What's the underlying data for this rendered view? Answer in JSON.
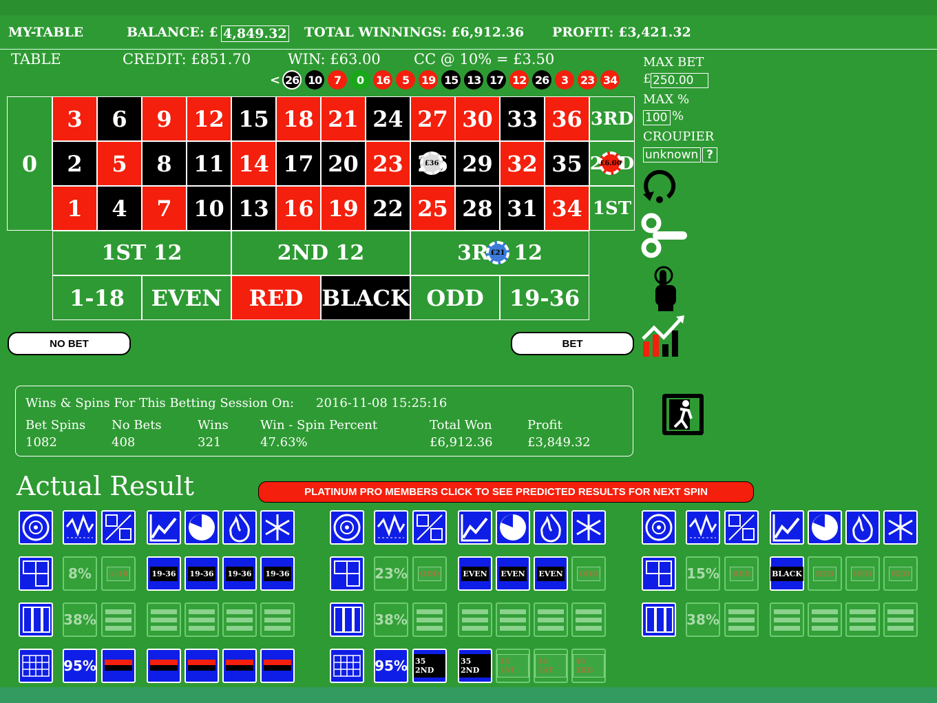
{
  "header": {
    "table": "MY-TABLE",
    "balance_label": "BALANCE: £",
    "balance_value": "4,849.32",
    "total_winnings": "TOTAL WINNINGS: £6,912.36",
    "profit": "PROFIT: £3,421.32"
  },
  "info": {
    "table": "TABLE",
    "credit": "CREDIT: £851.70",
    "win": "WIN: £63.00",
    "cc": "CC @ 10% = £3.50"
  },
  "side": {
    "max_bet_label": "MAX BET",
    "currency": "£",
    "max_bet_value": "250.00",
    "max_pct_label": "MAX %",
    "max_pct_value": "100",
    "pct_sign": "%",
    "croupier_label": "CROUPIER",
    "croupier_value": "unknown",
    "help": "?",
    "icons": [
      "refresh-icon",
      "wind-up-key-icon",
      "hand-pointer-icon",
      "profit-chart-icon",
      "exit-icon"
    ]
  },
  "history": {
    "arrow": "<",
    "numbers": [
      {
        "n": "26",
        "c": "black"
      },
      {
        "n": "10",
        "c": "black"
      },
      {
        "n": "7",
        "c": "red"
      },
      {
        "n": "0",
        "c": "green"
      },
      {
        "n": "16",
        "c": "red"
      },
      {
        "n": "5",
        "c": "red"
      },
      {
        "n": "19",
        "c": "red"
      },
      {
        "n": "15",
        "c": "black"
      },
      {
        "n": "13",
        "c": "black"
      },
      {
        "n": "17",
        "c": "black"
      },
      {
        "n": "12",
        "c": "red"
      },
      {
        "n": "26",
        "c": "black"
      },
      {
        "n": "3",
        "c": "red"
      },
      {
        "n": "23",
        "c": "red"
      },
      {
        "n": "34",
        "c": "red"
      }
    ]
  },
  "board": {
    "zero": "0",
    "rows": [
      [
        {
          "n": "3",
          "c": "red"
        },
        {
          "n": "6",
          "c": "black"
        },
        {
          "n": "9",
          "c": "red"
        },
        {
          "n": "12",
          "c": "red"
        },
        {
          "n": "15",
          "c": "black"
        },
        {
          "n": "18",
          "c": "red"
        },
        {
          "n": "21",
          "c": "red"
        },
        {
          "n": "24",
          "c": "black"
        },
        {
          "n": "27",
          "c": "red"
        },
        {
          "n": "30",
          "c": "red"
        },
        {
          "n": "33",
          "c": "black"
        },
        {
          "n": "36",
          "c": "red"
        }
      ],
      [
        {
          "n": "2",
          "c": "black"
        },
        {
          "n": "5",
          "c": "red"
        },
        {
          "n": "8",
          "c": "black"
        },
        {
          "n": "11",
          "c": "black"
        },
        {
          "n": "14",
          "c": "red"
        },
        {
          "n": "17",
          "c": "black"
        },
        {
          "n": "20",
          "c": "black"
        },
        {
          "n": "23",
          "c": "red"
        },
        {
          "n": "26",
          "c": "black"
        },
        {
          "n": "29",
          "c": "black"
        },
        {
          "n": "32",
          "c": "red"
        },
        {
          "n": "35",
          "c": "black"
        }
      ],
      [
        {
          "n": "1",
          "c": "red"
        },
        {
          "n": "4",
          "c": "black"
        },
        {
          "n": "7",
          "c": "red"
        },
        {
          "n": "10",
          "c": "black"
        },
        {
          "n": "13",
          "c": "black"
        },
        {
          "n": "16",
          "c": "red"
        },
        {
          "n": "19",
          "c": "red"
        },
        {
          "n": "22",
          "c": "black"
        },
        {
          "n": "25",
          "c": "red"
        },
        {
          "n": "28",
          "c": "black"
        },
        {
          "n": "31",
          "c": "black"
        },
        {
          "n": "34",
          "c": "red"
        }
      ]
    ],
    "columns": [
      "3RD",
      "2ND",
      "1ST"
    ],
    "dozens": [
      "1ST 12",
      "2ND 12",
      "3RD 12"
    ],
    "outside": [
      {
        "t": "1-18",
        "c": "green"
      },
      {
        "t": "EVEN",
        "c": "green"
      },
      {
        "t": "RED",
        "c": "red"
      },
      {
        "t": "BLACK",
        "c": "black"
      },
      {
        "t": "ODD",
        "c": "green"
      },
      {
        "t": "19-36",
        "c": "green"
      }
    ],
    "chips": [
      {
        "label": "£36",
        "target": "26"
      },
      {
        "label": "£6.00",
        "target": "2ND"
      },
      {
        "label": "£21",
        "target": "3RD 12"
      }
    ]
  },
  "buttons": {
    "no_bet": "NO BET",
    "bet": "BET"
  },
  "stats": {
    "title": "Wins & Spins For This Betting Session On:",
    "date": "2016-11-08 15:25:16",
    "headers": [
      "Bet Spins",
      "No Bets",
      "Wins",
      "Win - Spin Percent",
      "Total Won",
      "Profit"
    ],
    "values": [
      "1082",
      "408",
      "321",
      "47.63%",
      "£6,912.36",
      "£3,849.32"
    ]
  },
  "results": {
    "title": "Actual Result",
    "promo": "PLATINUM PRO MEMBERS CLICK TO SEE PREDICTED RESULTS FOR NEXT SPIN",
    "top_icons": [
      "roulette-wheel-icon",
      "wave-chart-icon",
      "split-icon",
      "line-chart-icon",
      "pie-icon",
      "fire-icon",
      "snowflake-icon"
    ],
    "groups": [
      {
        "row2_pct": "8%",
        "row2_lbl": "1-18",
        "row2_tags": [
          "19-36",
          "19-36",
          "19-36",
          "19-36"
        ],
        "row3_pct": "38%",
        "row4_pct": "95%"
      },
      {
        "row2_pct": "23%",
        "row2_lbl": "ODD",
        "row2_tags": [
          "EVEN",
          "EVEN",
          "EVEN",
          "ODD"
        ],
        "row3_pct": "38%",
        "row4_pct": "95%",
        "row4_tags": [
          "35 2ND",
          "35 2ND",
          "34 1ST",
          "34 1ST",
          "36 3RD"
        ]
      },
      {
        "row2_pct": "15%",
        "row2_lbl": "RED",
        "row2_tags": [
          "BLACK",
          "RED",
          "RED",
          "RED"
        ],
        "row3_pct": "38%"
      }
    ]
  }
}
